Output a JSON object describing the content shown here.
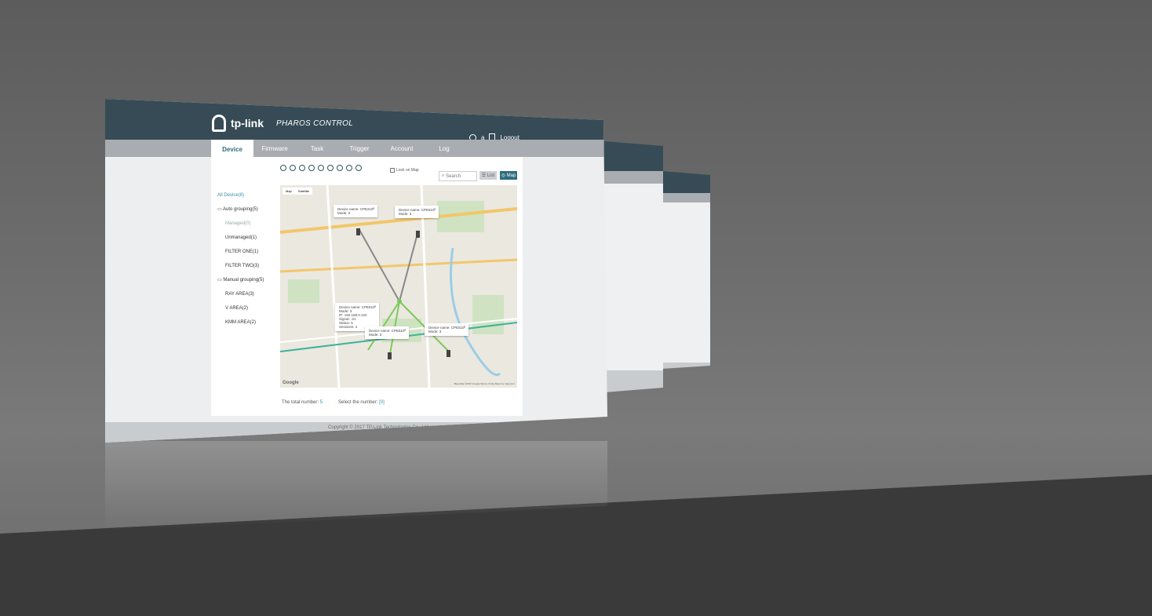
{
  "header": {
    "logo_text": "tp-link",
    "product": "PHAROS CONTROL",
    "user": "a",
    "logout": "Logout"
  },
  "tabs": [
    "Device",
    "Firmware",
    "Task",
    "Trigger",
    "Account",
    "Log"
  ],
  "toolbar": {
    "lock_label": "Lock on Map",
    "search_placeholder": "Search",
    "list_label": "List",
    "map_label": "Map"
  },
  "tree": {
    "all": "All Device(8)",
    "auto": "Auto grouping(5)",
    "managed": "Managed(0)",
    "unmanaged": "Unmanaged(1)",
    "filter_one": "FILTER ONE(1)",
    "filter_two": "FILTER TWO(3)",
    "manual": "Manual grouping(5)",
    "area_a": "RAY AREA(3)",
    "area_v": "V AREA(2)",
    "area_k": "KMM AREA(2)"
  },
  "map": {
    "tab_map": "Map",
    "tab_sat": "Satellite",
    "google": "Google",
    "attribution": "Map data ©2017 Google   Terms of Use   Report a map error",
    "popups": [
      {
        "name": "Device name:  CPE210",
        "line2": "Mode:  0"
      },
      {
        "name": "Device name:  CPE510",
        "line2": "Mode:  3"
      },
      {
        "name": "Device name:  CPE510",
        "line2": "Mode:  3",
        "line3": "IP:  192.168.0.122",
        "line4": "Signal:  -21",
        "line5": "Status:  5",
        "line6": "Sessions:  4"
      },
      {
        "name": "Device name:  CPE510",
        "line2": "Mode:  3"
      },
      {
        "name": "Device name:  CPE510",
        "line2": "Mode:  3"
      }
    ]
  },
  "totals": {
    "total_label": "The total number:",
    "total_value": "5",
    "select_label": "Select the number:",
    "select_value": "[0]"
  },
  "footer": {
    "copyright": "Copyright © 2017 TP-Link Technologies Co., Ltd."
  },
  "colors": {
    "header": "#364b55",
    "accent": "#2c6d7f",
    "band": "#a9acb0"
  }
}
